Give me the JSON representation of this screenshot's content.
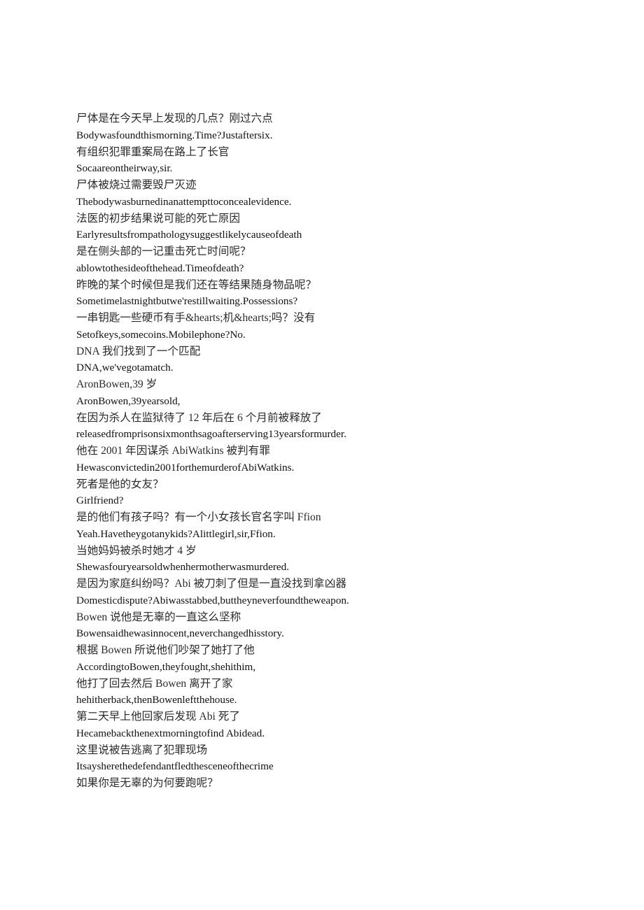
{
  "document": {
    "page_background": "#ffffff",
    "text_color_zh": "#2b2b2b",
    "text_color_en": "#111111",
    "lines": [
      {
        "lang": "zh",
        "text": "尸体是在今天早上发现的几点？刚过六点"
      },
      {
        "lang": "en",
        "text": "Bodywasfoundthismorning.Time?Justaftersix."
      },
      {
        "lang": "zh",
        "text": "有组织犯罪重案局在路上了长官"
      },
      {
        "lang": "en",
        "text": "Socaareontheirway,sir."
      },
      {
        "lang": "zh",
        "text": "尸体被烧过需要毁尸灭迹"
      },
      {
        "lang": "en",
        "text": "Thebodywasburnedinanattempttoconcealevidence."
      },
      {
        "lang": "zh",
        "text": "法医的初步结果说可能的死亡原因"
      },
      {
        "lang": "en",
        "text": "Earlyresultsfrompathologysuggestlikelycauseofdeath"
      },
      {
        "lang": "zh",
        "text": "是在侧头部的一记重击死亡时间呢？"
      },
      {
        "lang": "en",
        "text": "ablowtothesideofthehead.Timeofdeath?"
      },
      {
        "lang": "zh",
        "text": "昨晚的某个时候但是我们还在等结果随身物品呢？"
      },
      {
        "lang": "en",
        "text": "Sometimelastnightbutwe'restillwaiting.Possessions?"
      },
      {
        "lang": "zh",
        "text": "一串钥匙一些硬币有手&hearts;机&hearts;吗？没有"
      },
      {
        "lang": "en",
        "text": "Setofkeys,somecoins.Mobilephone?No."
      },
      {
        "lang": "zh",
        "text": "DNA 我们找到了一个匹配"
      },
      {
        "lang": "en",
        "text": "DNA,we'vegotamatch."
      },
      {
        "lang": "zh",
        "text": "AronBowen,39 岁"
      },
      {
        "lang": "en",
        "text": "AronBowen,39yearsold,"
      },
      {
        "lang": "zh",
        "text": "在因为杀人在监狱待了 12 年后在 6 个月前被释放了"
      },
      {
        "lang": "en",
        "text": "releasedfromprisonsixmonthsagoafterserving13yearsformurder."
      },
      {
        "lang": "zh",
        "text": "他在 2001 年因谋杀 AbiWatkins 被判有罪"
      },
      {
        "lang": "en",
        "text": "Hewasconvictedin2001forthemurderofAbiWatkins."
      },
      {
        "lang": "zh",
        "text": "死者是他的女友？"
      },
      {
        "lang": "en",
        "text": "Girlfriend?"
      },
      {
        "lang": "zh",
        "text": "是的他们有孩子吗？有一个小女孩长官名字叫 Ffion"
      },
      {
        "lang": "en",
        "text": "Yeah.Havetheygotanykids?Alittlegirl,sir,Ffion."
      },
      {
        "lang": "zh",
        "text": "当她妈妈被杀时她才 4 岁"
      },
      {
        "lang": "en",
        "text": "Shewasfouryearsoldwhenhermotherwasmurdered."
      },
      {
        "lang": "zh",
        "text": "是因为家庭纠纷吗？Abi 被刀刺了但是一直没找到拿凶器"
      },
      {
        "lang": "en",
        "text": "Domesticdispute?Abiwasstabbed,buttheyneverfoundtheweapon."
      },
      {
        "lang": "zh",
        "text": "Bowen 说他是无辜的一直这么坚称"
      },
      {
        "lang": "en",
        "text": "Bowensaidhewasinnocent,neverchangedhisstory."
      },
      {
        "lang": "zh",
        "text": "根据 Bowen 所说他们吵架了她打了他"
      },
      {
        "lang": "en",
        "text": "AccordingtoBowen,theyfought,shehithim,"
      },
      {
        "lang": "zh",
        "text": "他打了回去然后 Bowen 离开了家"
      },
      {
        "lang": "en",
        "text": "hehitherback,thenBowenleftthehouse."
      },
      {
        "lang": "zh",
        "text": "第二天早上他回家后发现 Abi 死了"
      },
      {
        "lang": "en",
        "text": "Hecamebackthenextmorningtofind Abidead."
      },
      {
        "lang": "zh",
        "text": "这里说被告逃离了犯罪现场"
      },
      {
        "lang": "en",
        "text": "Itsaysherethedefendantfledthesceneofthecrime"
      },
      {
        "lang": "zh",
        "text": "如果你是无辜的为何要跑呢？"
      }
    ]
  }
}
